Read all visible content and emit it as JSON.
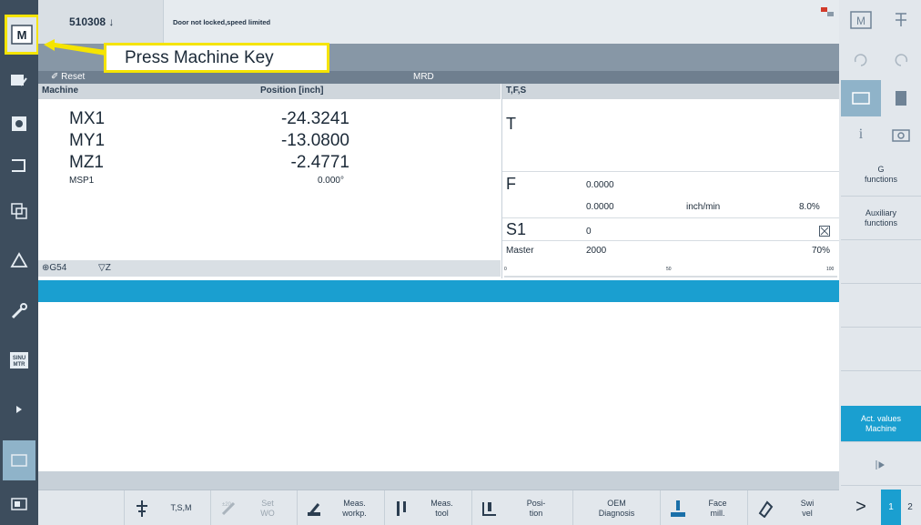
{
  "header": {
    "program_number": "510308",
    "program_arrow": "↓",
    "alarm_text": "Door not locked,speed limited"
  },
  "state": {
    "reset": "Reset",
    "mode": "MRD"
  },
  "callout": {
    "text": "Press Machine Key",
    "key_label": "M"
  },
  "axes": {
    "headers": {
      "machine": "Machine",
      "position": "Position [inch]"
    },
    "rows": [
      {
        "name": "MX1",
        "value": "-24.3241"
      },
      {
        "name": "MY1",
        "value": "-13.0800"
      },
      {
        "name": "MZ1",
        "value": "-2.4771"
      },
      {
        "name": "MSP1",
        "value": "0.000°"
      }
    ],
    "work_offset": "G54",
    "wo_axis": "Z"
  },
  "tfs": {
    "header": "T,F,S",
    "t_label": "T",
    "f_label": "F",
    "f_value_1": "0.0000",
    "f_value_2": "0.0000",
    "f_unit": "inch/min",
    "f_override": "8.0%",
    "s_label": "S1",
    "s_value": "0",
    "master_label": "Master",
    "master_value": "2000",
    "master_override": "70%",
    "scale_0": "0",
    "scale_50": "50",
    "scale_100": "100"
  },
  "bottom_softkeys": [
    {
      "label": "T,S,M",
      "icon": "tsm-icon"
    },
    {
      "label": "Set\nWO",
      "icon": "set-wo-icon"
    },
    {
      "label": "Meas.\nworkp.",
      "icon": "measure-workpiece-icon"
    },
    {
      "label": "Meas.\ntool",
      "icon": "measure-tool-icon"
    },
    {
      "label": "Posi-\ntion",
      "icon": "position-icon"
    },
    {
      "label": "OEM\nDiagnosis",
      "icon": ""
    },
    {
      "label": "Face\nmill.",
      "icon": "face-mill-icon"
    },
    {
      "label": "Swi\nvel",
      "icon": "swivel-icon"
    }
  ],
  "bottom_nav": {
    "next": ">",
    "page1": "1",
    "page2": "2"
  },
  "right_softkeys": {
    "g_functions": "G\nfunctions",
    "aux_functions": "Auxiliary\nfunctions",
    "act_values": "Act. values\nMachine"
  },
  "right_top": {
    "machine_key": "M",
    "info": "i"
  },
  "left_strip": {
    "sine_label": "SINU\nMTR"
  },
  "colors": {
    "accent_blue": "#1a9fd0",
    "callout_yellow": "#f5e400",
    "dark_strip": "#3d4d5d"
  }
}
